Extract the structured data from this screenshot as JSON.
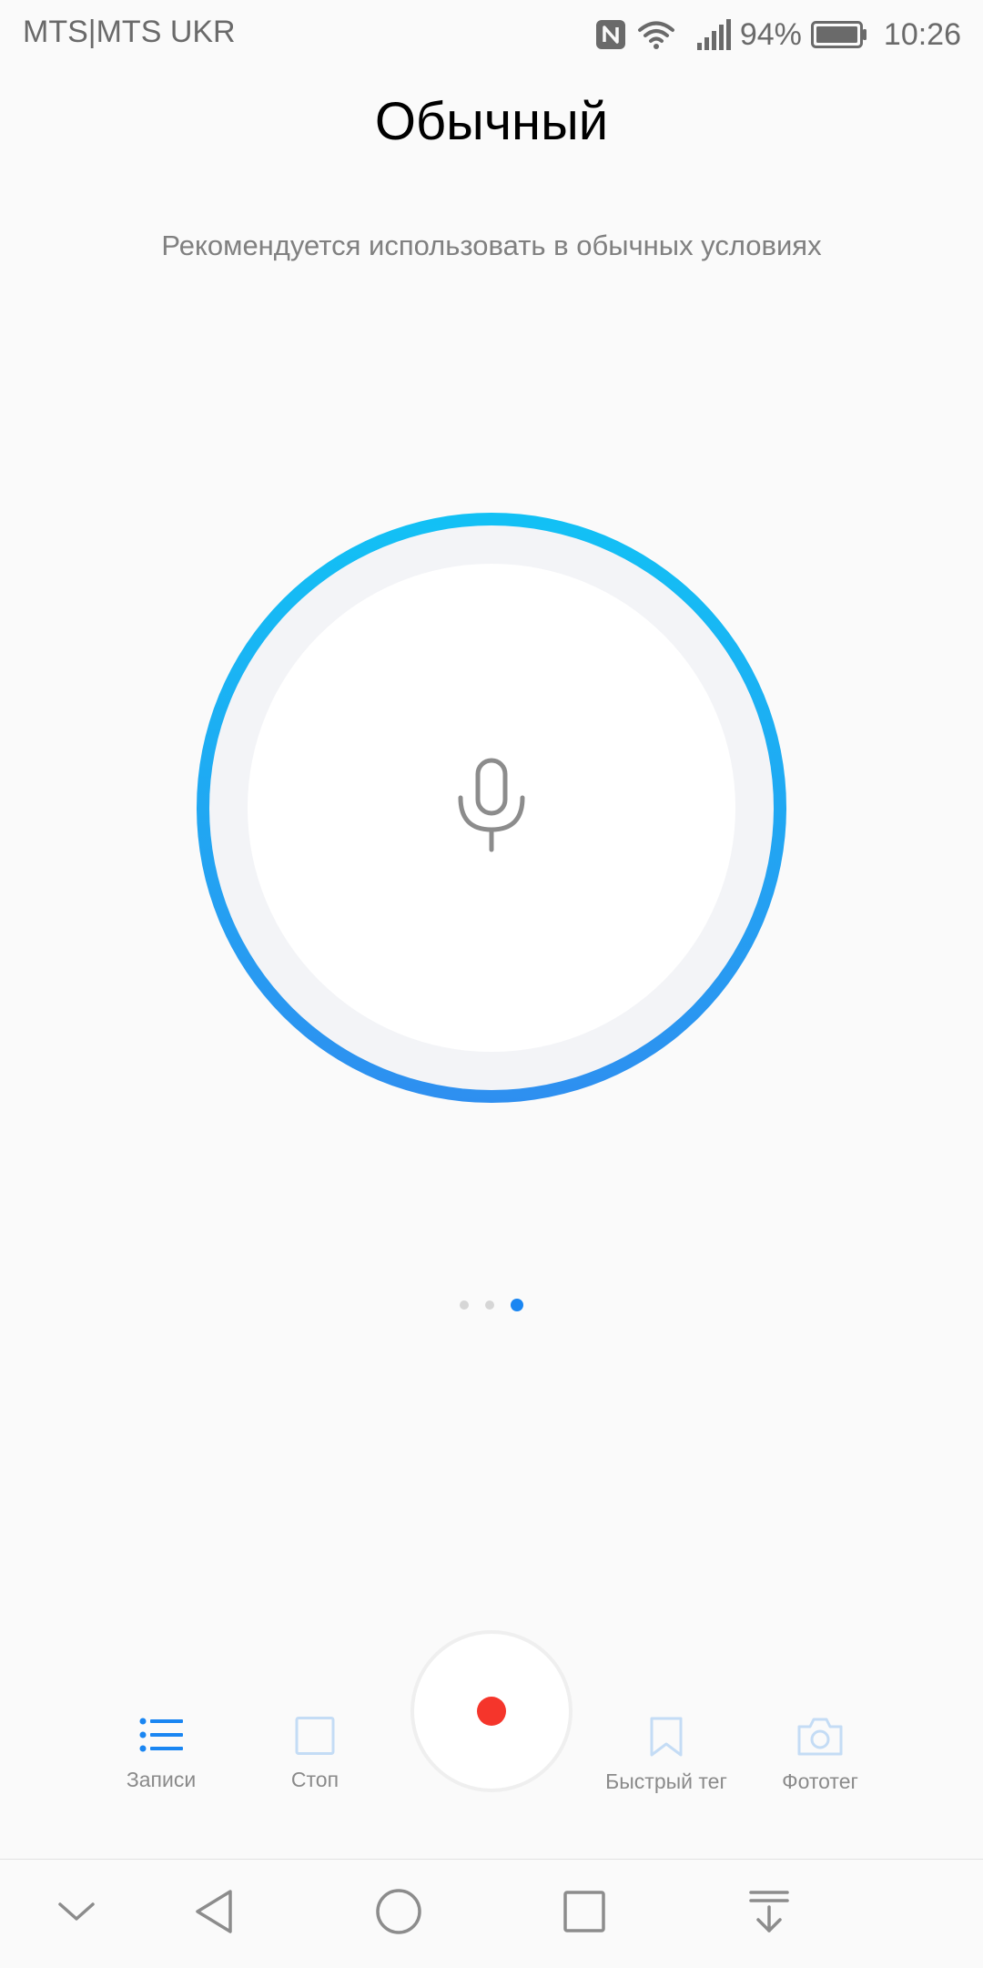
{
  "status_bar": {
    "carrier": "MTS|MTS UKR",
    "battery_percent": "94%",
    "time": "10:26",
    "icons": [
      "nfc-icon",
      "wifi-icon",
      "signal-icon",
      "battery-icon"
    ]
  },
  "mode": {
    "title": "Обычный",
    "description": "Рекомендуется использовать в обычных условиях"
  },
  "pager": {
    "count": 3,
    "active_index": 2
  },
  "toolbar": {
    "records_label": "Записи",
    "stop_label": "Стоп",
    "quick_tag_label": "Быстрый тег",
    "photo_tag_label": "Фототег"
  },
  "colors": {
    "accent": "#1a86f2",
    "ring_top": "#12c1f5",
    "ring_bottom": "#2e8ff0",
    "record_red": "#f5352b",
    "disabled_icon": "#c4dcf5"
  },
  "nav_bar": {
    "icons": [
      "chevron-down-icon",
      "back-icon",
      "home-icon",
      "recents-icon",
      "notifications-pull-icon"
    ]
  }
}
